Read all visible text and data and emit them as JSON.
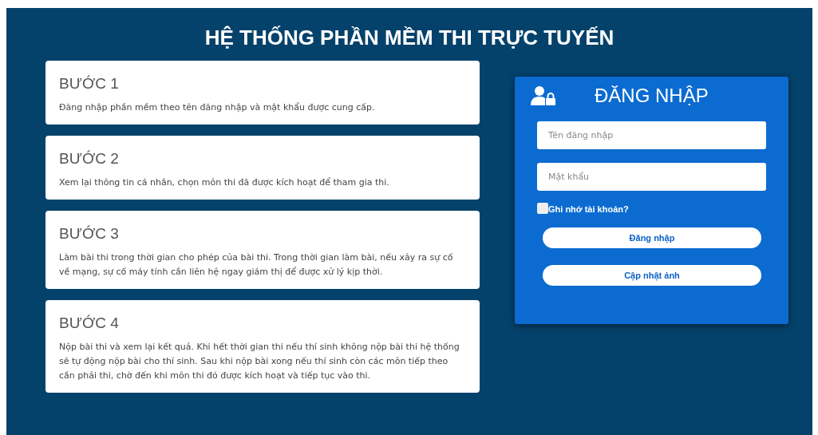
{
  "page": {
    "title": "HỆ THỐNG PHẦN MỀM THI TRỰC TUYẾN"
  },
  "steps": [
    {
      "heading": "BƯỚC 1",
      "text": "Đăng nhập phần mềm theo tên đăng nhập và mật khẩu được cung cấp."
    },
    {
      "heading": "BƯỚC 2",
      "text": "Xem lại thông tin cá nhân, chọn môn thi đã được kích hoạt để tham gia thi."
    },
    {
      "heading": "BƯỚC 3",
      "text": "Làm bài thi trong thời gian cho phép của bài thi. Trong thời gian làm bài, nếu xảy ra sự cố về mạng, sự cố máy tính cần liên hệ ngay giám thị để được xử lý kịp thời."
    },
    {
      "heading": "BƯỚC 4",
      "text": "Nộp bài thi và xem lại kết quả. Khi hết thời gian thi nếu thí sinh không nộp bài thi hệ thống sẽ tự động nộp bài cho thí sinh. Sau khi nộp bài xong nếu thí sinh còn các môn tiếp theo cần phải thi, chờ đến khi môn thi đó được kích hoạt và tiếp tục vào thi."
    }
  ],
  "login": {
    "title": "ĐĂNG NHẬP",
    "fields": [
      {
        "placeholder": "Tên đăng nhập"
      },
      {
        "placeholder": "Mật khẩu"
      }
    ],
    "remember": {
      "label": "Ghi nhớ tài khoản?",
      "checked": false
    },
    "buttons": [
      "Đăng nhập",
      "Cập nhật ảnh"
    ]
  }
}
